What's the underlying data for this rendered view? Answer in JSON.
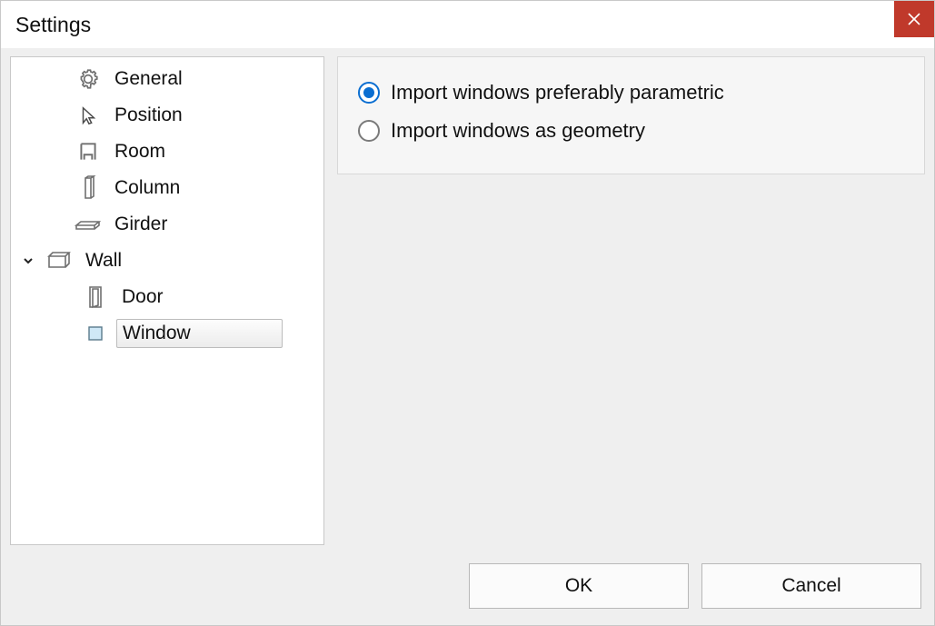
{
  "title": "Settings",
  "sidebar": {
    "items": [
      {
        "id": "general",
        "label": "General",
        "icon": "gear-icon",
        "indent": 1
      },
      {
        "id": "position",
        "label": "Position",
        "icon": "cursor-icon",
        "indent": 1
      },
      {
        "id": "room",
        "label": "Room",
        "icon": "room-icon",
        "indent": 1
      },
      {
        "id": "column",
        "label": "Column",
        "icon": "column-icon",
        "indent": 1
      },
      {
        "id": "girder",
        "label": "Girder",
        "icon": "girder-icon",
        "indent": 1
      },
      {
        "id": "wall",
        "label": "Wall",
        "icon": "wall-icon",
        "indent": 0,
        "expanded": true
      },
      {
        "id": "door",
        "label": "Door",
        "icon": "door-icon",
        "indent": 2
      },
      {
        "id": "window",
        "label": "Window",
        "icon": "window-icon",
        "indent": 2,
        "selected": true
      }
    ]
  },
  "options": {
    "radio": [
      {
        "id": "parametric",
        "label": "Import windows preferably parametric",
        "checked": true
      },
      {
        "id": "geometry",
        "label": "Import windows as geometry",
        "checked": false
      }
    ]
  },
  "buttons": {
    "ok": "OK",
    "cancel": "Cancel"
  }
}
